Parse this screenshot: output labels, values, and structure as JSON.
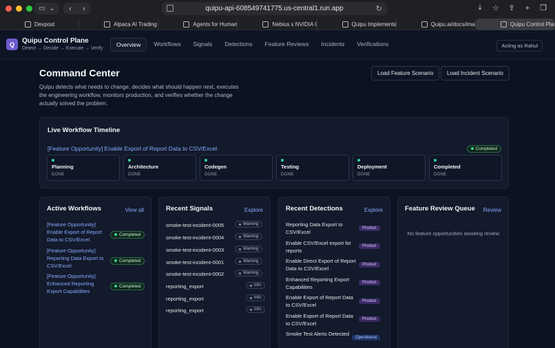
{
  "browser": {
    "url": "quipu-api-608549741775.us-central1.run.app",
    "tabs": [
      {
        "label": "Devpost",
        "active": false
      },
      {
        "label": "Alpaca AI Trading Agen...",
        "active": false
      },
      {
        "label": "Agents for Humans Ha...",
        "active": false
      },
      {
        "label": "Nebius x NVIDIA Globa...",
        "active": false
      },
      {
        "label": "Quipu Implementation...",
        "active": false
      },
      {
        "label": "Quipu.ai/docs/images/...",
        "active": false
      },
      {
        "label": "Quipu Control Plane",
        "active": true
      }
    ]
  },
  "app": {
    "logo_letter": "Q",
    "title": "Quipu Control Plane",
    "subtitle": "Detect → Decide → Execute → Verify",
    "nav": [
      "Overview",
      "Workflows",
      "Signals",
      "Detections",
      "Feature Reviews",
      "Incidents",
      "Verifications"
    ],
    "acting_as": "Acting as Rahul"
  },
  "main": {
    "title": "Command Center",
    "load_feature_btn": "Load Feature Scenario",
    "load_incident_btn": "Load Incident Scenario",
    "description": "Quipu detects what needs to change, decides what should happen next, executes the engineering workflow, monitors production, and verifies whether the change actually solved the problem."
  },
  "timeline": {
    "title": "Live Workflow Timeline",
    "workflow_name": "[Feature Opportunity] Enable Export of Report Data to CSV/Excel",
    "status": "Completed",
    "stages": [
      {
        "name": "Planning",
        "status": "DONE"
      },
      {
        "name": "Architecture",
        "status": "DONE"
      },
      {
        "name": "Codegen",
        "status": "DONE"
      },
      {
        "name": "Testing",
        "status": "DONE"
      },
      {
        "name": "Deployment",
        "status": "DONE"
      },
      {
        "name": "Completed",
        "status": "DONE"
      }
    ]
  },
  "active_workflows": {
    "title": "Active Workflows",
    "link": "View all",
    "items": [
      {
        "name": "[Feature Opportunity] Enable Export of Report Data to CSV/Excel",
        "status": "Completed"
      },
      {
        "name": "[Feature Opportunity] Reporting Data Export to CSV/Excel",
        "status": "Completed"
      },
      {
        "name": "[Feature Opportunity] Enhanced Reporting Export Capabilities",
        "status": "Completed"
      }
    ]
  },
  "recent_signals": {
    "title": "Recent Signals",
    "link": "Explore",
    "items": [
      {
        "name": "smoke-test-incident-0005",
        "level": "Warning"
      },
      {
        "name": "smoke-test-incident-0004",
        "level": "Warning"
      },
      {
        "name": "smoke-test-incident-0003",
        "level": "Warning"
      },
      {
        "name": "smoke-test-incident-0001",
        "level": "Warning"
      },
      {
        "name": "smoke-test-incident-0002",
        "level": "Warning"
      },
      {
        "name": "reporting_export",
        "level": "Info"
      },
      {
        "name": "reporting_export",
        "level": "Info"
      },
      {
        "name": "reporting_export",
        "level": "Info"
      }
    ]
  },
  "recent_detections": {
    "title": "Recent Detections",
    "link": "Explore",
    "items": [
      {
        "name": "Reporting Data Export to CSV/Excel",
        "tag": "Product"
      },
      {
        "name": "Enable CSV/Excel export for reports",
        "tag": "Product"
      },
      {
        "name": "Enable Direct Export of Report Data to CSV/Excel",
        "tag": "Product"
      },
      {
        "name": "Enhanced Reporting Export Capabilities",
        "tag": "Product"
      },
      {
        "name": "Enable Export of Report Data to CSV/Excel",
        "tag": "Product"
      },
      {
        "name": "Enable Export of Report Data to CSV/Excel",
        "tag": "Product"
      },
      {
        "name": "Smoke Test Alerts Detected",
        "tag": "Operational"
      }
    ]
  },
  "feature_review": {
    "title": "Feature Review Queue",
    "link": "Review",
    "empty_text": "No feature opportunities awaiting review."
  },
  "colors": {
    "accent": "#8ba7ff",
    "success": "#34d399",
    "background": "#0b1220",
    "card": "#121a2b"
  }
}
